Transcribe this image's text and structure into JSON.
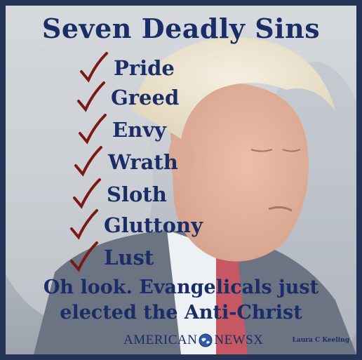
{
  "title": "Seven Deadly Sins",
  "sins": [
    "Pride",
    "Greed",
    "Envy",
    "Wrath",
    "Sloth",
    "Gluttony",
    "Lust"
  ],
  "caption_line1": "Oh look. Evangelicals just",
  "caption_line2": "elected the Anti-Christ",
  "brand_left": "AMERICAN",
  "brand_right": "NEWSX",
  "credit": "Laura C Keeling",
  "icons": {
    "check": "checkmark-icon",
    "globe": "globe-icon"
  },
  "colors": {
    "text": "#1a2d66",
    "check": "#7a1a12",
    "border": "#243456"
  }
}
